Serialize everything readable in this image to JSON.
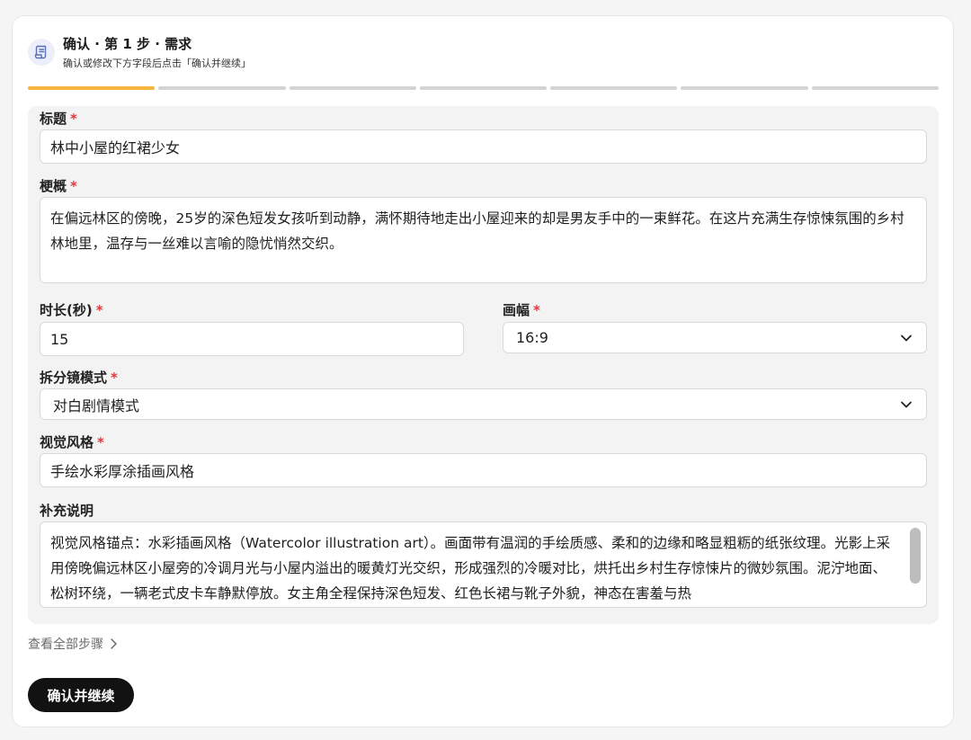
{
  "header": {
    "title": "确认 · 第 1 步 · 需求",
    "subtitle": "确认或修改下方字段后点击「确认并继续」"
  },
  "steps": {
    "total": 7,
    "current": 1
  },
  "required_mark": "*",
  "fields": {
    "title": {
      "label": "标题",
      "value": "林中小屋的红裙少女"
    },
    "synopsis": {
      "label": "梗概",
      "value": "在偏远林区的傍晚，25岁的深色短发女孩听到动静，满怀期待地走出小屋迎来的却是男友手中的一束鲜花。在这片充满生存惊悚氛围的乡村林地里，温存与一丝难以言喻的隐忧悄然交织。"
    },
    "duration": {
      "label": "时长(秒)",
      "value": "15"
    },
    "aspect": {
      "label": "画幅",
      "value": "16:9"
    },
    "mode": {
      "label": "拆分镜模式",
      "value": "对白剧情模式"
    },
    "style": {
      "label": "视觉风格",
      "value": "手绘水彩厚涂插画风格"
    },
    "notes": {
      "label": "补充说明",
      "value": "视觉风格锚点：水彩插画风格（Watercolor illustration art）。画面带有温润的手绘质感、柔和的边缘和略显粗粝的纸张纹理。光影上采用傍晚偏远林区小屋旁的冷调月光与小屋内溢出的暖黄灯光交织，形成强烈的冷暖对比，烘托出乡村生存惊悚片的微妙氛围。泥泞地面、松树环绕，一辆老式皮卡车静默停放。女主角全程保持深色短发、红色长裙与靴子外貌，神态在害羞与热"
    }
  },
  "view_all": "查看全部步骤",
  "confirm_button": "确认并继续",
  "colors": {
    "accent": "#f5b53f",
    "required": "#e0383e",
    "button": "#121212"
  }
}
